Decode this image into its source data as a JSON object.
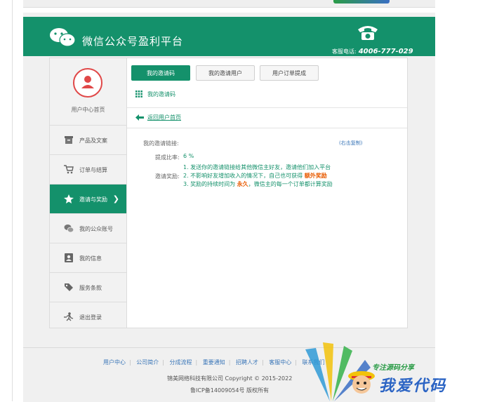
{
  "header": {
    "brand": "微信公众号盈利平台",
    "hotline_label": "客服电话:",
    "hotline_number": "4006-777-029"
  },
  "sidebar": {
    "user_center": "用户中心首页",
    "items": [
      {
        "label": "产品及文案",
        "icon": "box-icon"
      },
      {
        "label": "订单与结算",
        "icon": "cart-icon"
      },
      {
        "label": "邀请与奖励",
        "icon": "star-icon",
        "active": true,
        "arrow": "❯"
      },
      {
        "label": "我的公众账号",
        "icon": "wechat-icon"
      },
      {
        "label": "我的信息",
        "icon": "contact-icon"
      },
      {
        "label": "服务条款",
        "icon": "tag-icon"
      },
      {
        "label": "退出登录",
        "icon": "exit-icon"
      }
    ]
  },
  "tabs": [
    {
      "label": "我的邀请码",
      "active": true
    },
    {
      "label": "我的邀请用户",
      "active": false
    },
    {
      "label": "用户订单提成",
      "active": false
    }
  ],
  "section": {
    "title": "我的邀请码",
    "back_link": "返回用户首页"
  },
  "invite": {
    "link_label": "我的邀请链接:",
    "copy_hint": "(右击复制)",
    "rate_label": "提成比率:",
    "rate_value": "6 %",
    "reward_label": "邀请奖励:",
    "rule1": "1. 发送你的邀请链接给其他微信主好友，邀请他们加入平台",
    "rule2_a": "2. 不影响好友增加收入的情况下，自己也可获得",
    "rule2_hl": "额外奖励",
    "rule3_a": "3. 奖励的持续时间为",
    "rule3_hl": "永久",
    "rule3_b": "，微信主的每一个订单都计算奖励"
  },
  "footer": {
    "nav": [
      "用户中心",
      "公司简介",
      "分成流程",
      "重要通知",
      "招聘人才",
      "客服中心",
      "联系我们"
    ],
    "copyright": "锦美网络科技有限公司 Copyright © 2015-2022",
    "icp": "鲁ICP备14009054号 版权所有"
  },
  "watermark": {
    "line1": "专注源码分享",
    "line2": "我爱代码"
  },
  "colors": {
    "primary": "#14916b",
    "accent": "#e85a00",
    "link": "#3a76b8",
    "avatar": "#e04848"
  }
}
